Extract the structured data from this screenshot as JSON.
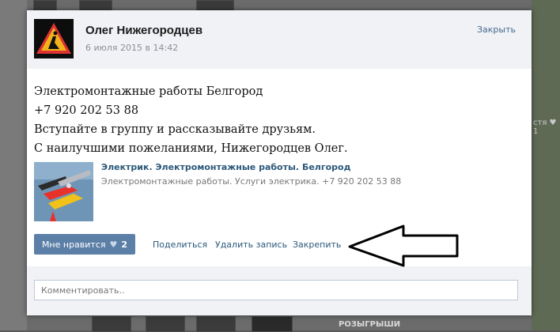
{
  "background": {
    "partial_text_1": "стя ♥ 1",
    "partial_text_2": "РОЗЫГРЫШИ"
  },
  "post": {
    "author": "Олег Нижегородцев",
    "date": "6 июля 2015 в 14:42",
    "close_label": "Закрыть",
    "text_lines": [
      "Электромонтажные работы Белгород",
      "+7 920 202 53 88",
      "Вступайте в группу и рассказывайте друзьям.",
      "С наилучшими пожеланиями, Нижегородцев Олег."
    ],
    "attachment": {
      "title": "Электрик. Электромонтажные работы. Белгород",
      "description": "Электромонтажные работы. Услуги электрика. +7 920 202 53 88"
    },
    "actions": {
      "like_label": "Мне нравится",
      "like_count": "2",
      "share_label": "Поделиться",
      "delete_label": "Удалить запись",
      "pin_label": "Закрепить"
    },
    "comment_placeholder": "Комментировать.."
  },
  "colors": {
    "link": "#2b587a",
    "like_button": "#5b7fa6",
    "header_bg": "#f0f2f5"
  },
  "icons": [
    "warning-avatar-icon",
    "heart-icon",
    "left-arrow-annotation"
  ]
}
